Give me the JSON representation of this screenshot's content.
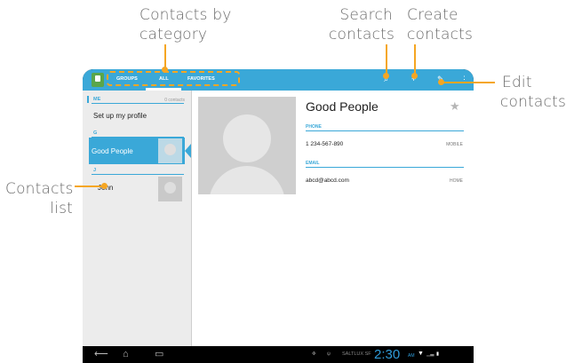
{
  "callouts": {
    "contacts_by_category_line1": "Contacts by",
    "contacts_by_category_line2": "category",
    "search_contacts_line1": "Search",
    "search_contacts_line2": "contacts",
    "create_contacts_line1": "Create",
    "create_contacts_line2": "contacts",
    "edit_contacts_line1": "Edit",
    "edit_contacts_line2": "contacts",
    "contacts_list_line1": "Contacts",
    "contacts_list_line2": "list"
  },
  "actionbar": {
    "tabs": [
      "GROUPS",
      "ALL",
      "FAVORITES"
    ],
    "selected_tab": "ALL",
    "icons": [
      "contacts-app-icon",
      "search-icon",
      "add-contact-icon",
      "edit-icon",
      "overflow-menu-icon"
    ]
  },
  "sidebar": {
    "me_label": "ME",
    "me_count": "0 contacts",
    "setup_profile": "Set up my profile",
    "section_g": "G",
    "section_j": "J",
    "contacts": [
      "Good People",
      "John"
    ],
    "selected_contact": "Good People"
  },
  "detail": {
    "name": "Good People",
    "phone_label": "PHONE",
    "phone_number": "1 234-567-890",
    "phone_type": "MOBILE",
    "email_label": "EMAIL",
    "email_address": "abcd@abcd.com",
    "email_type": "HOME"
  },
  "status_bar": {
    "carrier": "SALTLUX SF",
    "time": "2:30",
    "ampm": "AM"
  },
  "colors": {
    "accent": "#3aa8d8",
    "callout": "#f5a623",
    "sidebar_bg": "#ececec"
  }
}
